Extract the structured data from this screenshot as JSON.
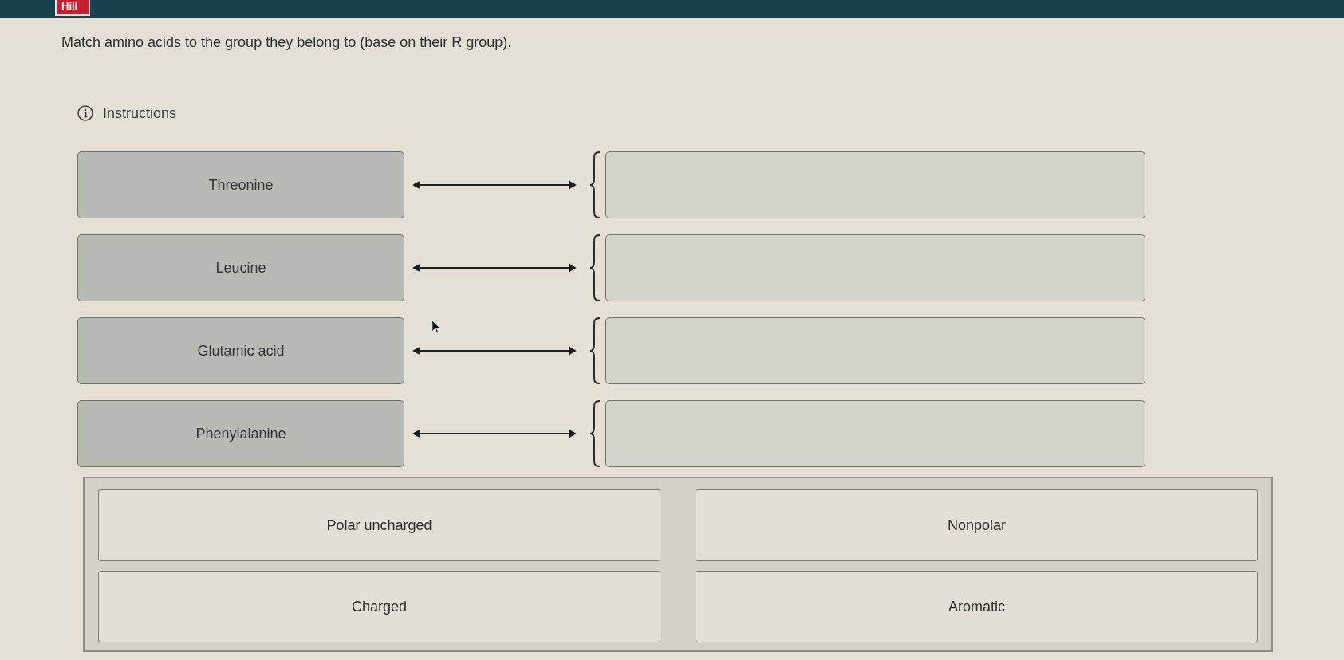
{
  "header": {
    "logo": "Hill"
  },
  "question": {
    "prompt": "Match amino acids to the group they belong to (base on their R group).",
    "instructions_link": "Instructions"
  },
  "matching": {
    "prompts": [
      {
        "label": "Threonine"
      },
      {
        "label": "Leucine"
      },
      {
        "label": "Glutamic acid"
      },
      {
        "label": "Phenylalanine"
      }
    ]
  },
  "answer_pool": {
    "choices": [
      {
        "label": "Polar uncharged"
      },
      {
        "label": "Nonpolar"
      },
      {
        "label": "Charged"
      },
      {
        "label": "Aromatic"
      }
    ]
  }
}
